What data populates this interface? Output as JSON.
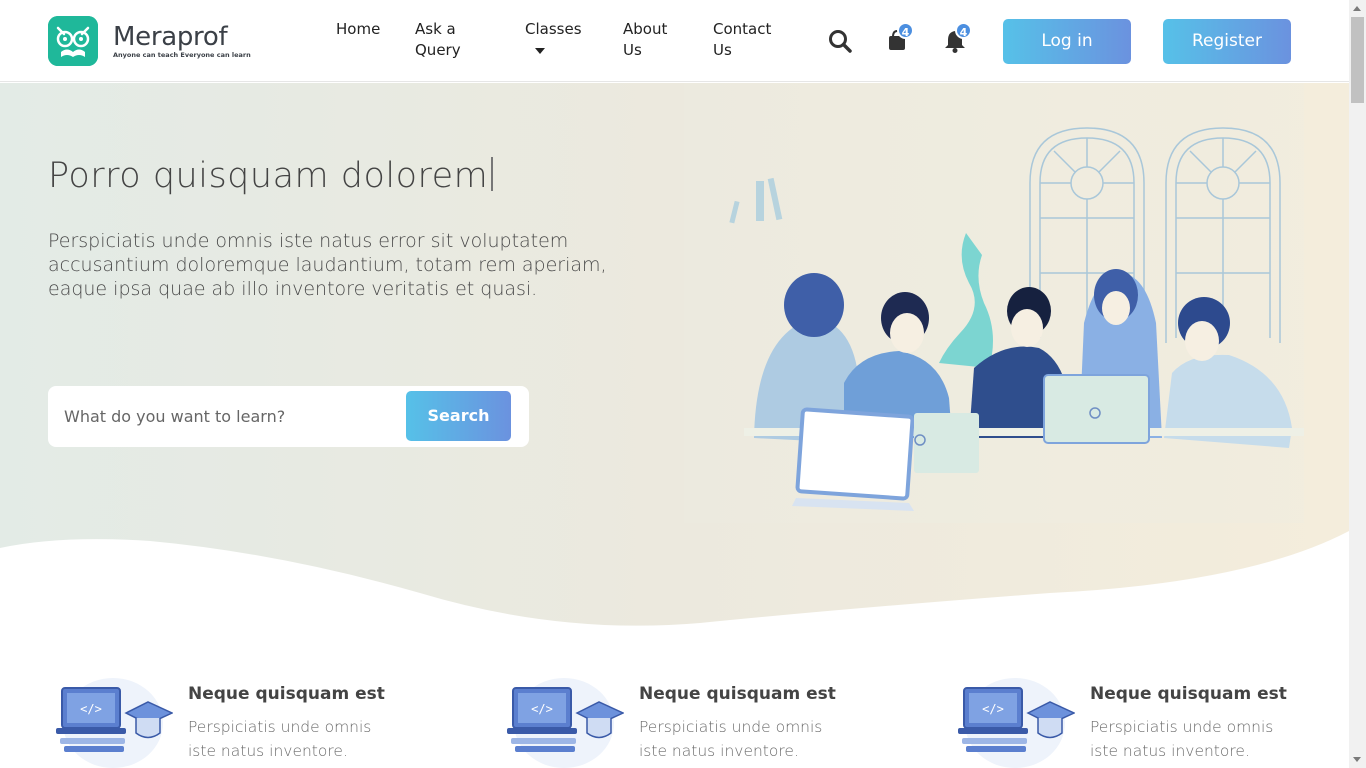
{
  "header": {
    "logo": {
      "name": "Meraprof",
      "tagline": "Anyone can teach Everyone can learn",
      "icon": "owl-glasses-icon",
      "brand_color": "#1fb89a"
    },
    "nav": [
      {
        "label": "Ask a Query"
      },
      {
        "label": "Classes",
        "icon": "caret-down-icon"
      },
      {
        "label": "About Us"
      },
      {
        "label": "Contact Us"
      }
    ],
    "home_label": "Home",
    "icons": {
      "search": "search-icon",
      "cart": "shopping-bag-icon",
      "notifications": "bell-icon"
    },
    "cart_count": "4",
    "notification_count": "4",
    "login_label": "Log in",
    "register_label": "Register",
    "accent_gradient": [
      "#56c1e8",
      "#6b92df"
    ]
  },
  "hero": {
    "title": "Porro quisquam dolorem",
    "subtitle": "Perspiciatis unde omnis iste natus error sit voluptatem accusantium doloremque laudantium, totam rem aperiam, eaque ipsa quae ab illo inventore veritatis et quasi.",
    "search": {
      "placeholder": "What do you want to learn?",
      "button_label": "Search"
    },
    "background_colors": [
      "#e3ebe6",
      "#f4eddc"
    ]
  },
  "features": [
    {
      "title": "Neque quisquam est",
      "description": "Perspiciatis unde omnis iste natus inventore.",
      "icon": "laptop-graduation-cap-icon"
    },
    {
      "title": "Neque quisquam est",
      "description": "Perspiciatis unde omnis iste natus inventore.",
      "icon": "laptop-graduation-cap-icon"
    },
    {
      "title": "Neque quisquam est",
      "description": "Perspiciatis unde omnis iste natus inventore.",
      "icon": "laptop-graduation-cap-icon"
    }
  ]
}
